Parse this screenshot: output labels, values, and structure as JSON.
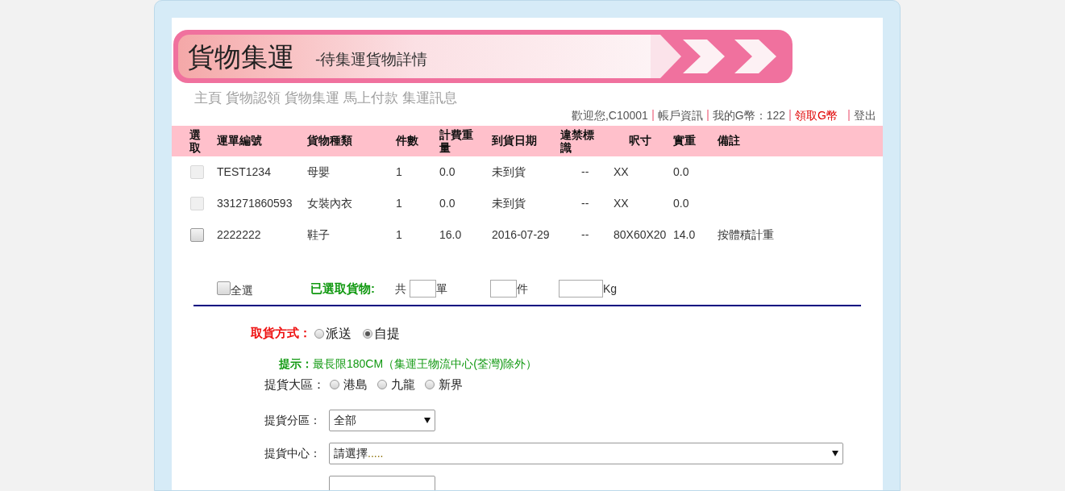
{
  "banner": {
    "title": "貨物集運",
    "subtitle": "-待集運貨物詳情"
  },
  "nav": [
    "主頁",
    "貨物認領",
    "貨物集運",
    "馬上付款",
    "集運訊息"
  ],
  "user_bar": [
    {
      "text": "歡迎您,C10001",
      "kind": "plain"
    },
    {
      "text": "帳戶資訊",
      "kind": "link"
    },
    {
      "text": "我的G幣：122",
      "kind": "plain"
    },
    {
      "text": "領取G幣",
      "kind": "highlight"
    },
    {
      "text": "登出",
      "kind": "link"
    }
  ],
  "table": {
    "select_column": "選取",
    "columns": [
      "運單編號",
      "貨物種類",
      "件數",
      "計費重量",
      "到貨日期",
      "違禁標識",
      "呎寸",
      "實重",
      "備註"
    ],
    "rows": [
      {
        "checked": false,
        "disabled": true,
        "cells": [
          "TEST1234",
          "母嬰",
          "1",
          "0.0",
          "未到貨",
          "--",
          "XX",
          "0.0",
          ""
        ]
      },
      {
        "checked": false,
        "disabled": true,
        "cells": [
          "331271860593",
          "女裝內衣",
          "1",
          "0.0",
          "未到貨",
          "--",
          "XX",
          "0.0",
          ""
        ]
      },
      {
        "checked": false,
        "disabled": false,
        "cells": [
          "2222222",
          "鞋子",
          "1",
          "16.0",
          "2016-07-29",
          "--",
          "80X60X20",
          "14.0",
          "按體積計重"
        ]
      }
    ]
  },
  "summary": {
    "select_all": {
      "label": "全選",
      "checked": false
    },
    "selected_label": "已選取貨物:",
    "total_prefix": "共",
    "unit_orders": "單",
    "unit_pieces": "件",
    "unit_weight": "Kg"
  },
  "pickup_method": {
    "label": "取貨方式：",
    "options": [
      {
        "label": "派送",
        "selected": false
      },
      {
        "label": "自提",
        "selected": true
      }
    ]
  },
  "hint": {
    "label": "提示：",
    "text": "最長限180CM（集運王物流中心(荃灣)除外）"
  },
  "pickup_region": {
    "label": "提貨大區：",
    "options": [
      {
        "label": "港島",
        "selected": false
      },
      {
        "label": "九龍",
        "selected": false
      },
      {
        "label": "新界",
        "selected": false
      }
    ]
  },
  "pickup_district": {
    "label": "提貨分區：",
    "value": "全部"
  },
  "pickup_center": {
    "label": "提貨中心：",
    "value": "請選擇",
    "value_suffix": "....."
  }
}
